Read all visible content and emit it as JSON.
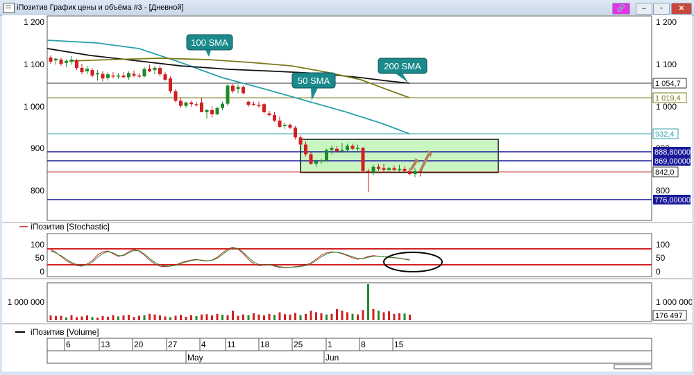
{
  "window": {
    "title": "iПозитив График цены и объёма #3 - [Дневной]",
    "pin_glyph": "🔗",
    "min_glyph": "–",
    "max_glyph": "▫",
    "close_glyph": "✕"
  },
  "price_panel": {
    "y_ticks": [
      "1 200",
      "1 100",
      "1 000",
      "900",
      "800"
    ],
    "right_ticks": [
      "1 200",
      "1 100",
      "1 000",
      "900",
      "800"
    ],
    "labels": {
      "sma100_value": "1 054,7",
      "sma200_value": "1 019,4",
      "sma50_value": "932,4",
      "level_888": "888,80000",
      "level_869": "869,00000",
      "last_close": "842,0",
      "level_776": "776,00000"
    },
    "callouts": {
      "sma100": "100 SMA",
      "sma50": "50 SMA",
      "sma200": "200 SMA"
    }
  },
  "stochastic_panel": {
    "title": "iПозитив [Stochastic]",
    "y_ticks": [
      "100",
      "50",
      "0"
    ],
    "right_ticks": [
      "100",
      "50",
      "0"
    ]
  },
  "volume_panel": {
    "y_tick": "1 000 000",
    "right_tick": "1 000 000",
    "last_volume": "176 497",
    "legend": "iПозитив [Volume]"
  },
  "time_axis": {
    "day_labels": [
      "6",
      "13",
      "20",
      "27",
      "4",
      "11",
      "18",
      "25",
      "1",
      "8",
      "15"
    ],
    "month_labels": [
      "May",
      "Jun"
    ]
  },
  "colors": {
    "up": "#1f8a2a",
    "down": "#d21f22",
    "sma100": "#2aa0ab",
    "sma200": "#7a7a18",
    "sma_black": "#111111",
    "level_blue": "#1a1a9a",
    "support": "#d21f22",
    "callout": "#1b8a8c",
    "zone_fill": "#c8f5c2"
  },
  "chart_data": [
    {
      "type": "candlestick",
      "ylim": [
        760,
        1200
      ],
      "candles": [
        {
          "o": 1115,
          "h": 1120,
          "l": 1100,
          "c": 1105
        },
        {
          "o": 1108,
          "h": 1115,
          "l": 1098,
          "c": 1112
        },
        {
          "o": 1110,
          "h": 1114,
          "l": 1095,
          "c": 1100
        },
        {
          "o": 1102,
          "h": 1110,
          "l": 1092,
          "c": 1107
        },
        {
          "o": 1105,
          "h": 1118,
          "l": 1098,
          "c": 1110
        },
        {
          "o": 1108,
          "h": 1112,
          "l": 1085,
          "c": 1090
        },
        {
          "o": 1090,
          "h": 1100,
          "l": 1075,
          "c": 1080
        },
        {
          "o": 1082,
          "h": 1095,
          "l": 1075,
          "c": 1088
        },
        {
          "o": 1085,
          "h": 1090,
          "l": 1068,
          "c": 1072
        },
        {
          "o": 1075,
          "h": 1085,
          "l": 1060,
          "c": 1078
        },
        {
          "o": 1076,
          "h": 1082,
          "l": 1058,
          "c": 1065
        },
        {
          "o": 1066,
          "h": 1080,
          "l": 1060,
          "c": 1075
        },
        {
          "o": 1072,
          "h": 1080,
          "l": 1065,
          "c": 1070
        },
        {
          "o": 1070,
          "h": 1078,
          "l": 1064,
          "c": 1072
        },
        {
          "o": 1072,
          "h": 1080,
          "l": 1066,
          "c": 1068
        },
        {
          "o": 1068,
          "h": 1082,
          "l": 1062,
          "c": 1078
        },
        {
          "o": 1076,
          "h": 1084,
          "l": 1068,
          "c": 1072
        },
        {
          "o": 1072,
          "h": 1078,
          "l": 1066,
          "c": 1070
        },
        {
          "o": 1070,
          "h": 1092,
          "l": 1068,
          "c": 1088
        },
        {
          "o": 1088,
          "h": 1098,
          "l": 1080,
          "c": 1082
        },
        {
          "o": 1085,
          "h": 1095,
          "l": 1075,
          "c": 1090
        },
        {
          "o": 1090,
          "h": 1096,
          "l": 1070,
          "c": 1075
        },
        {
          "o": 1075,
          "h": 1080,
          "l": 1060,
          "c": 1062
        },
        {
          "o": 1065,
          "h": 1070,
          "l": 1030,
          "c": 1035
        },
        {
          "o": 1035,
          "h": 1040,
          "l": 1008,
          "c": 1012
        },
        {
          "o": 1012,
          "h": 1020,
          "l": 995,
          "c": 1000
        },
        {
          "o": 1000,
          "h": 1010,
          "l": 995,
          "c": 1008
        },
        {
          "o": 1008,
          "h": 1012,
          "l": 998,
          "c": 1004
        },
        {
          "o": 1004,
          "h": 1010,
          "l": 998,
          "c": 1002
        },
        {
          "o": 1008,
          "h": 1020,
          "l": 990,
          "c": 985
        },
        {
          "o": 985,
          "h": 992,
          "l": 970,
          "c": 990
        },
        {
          "o": 990,
          "h": 1000,
          "l": 972,
          "c": 980
        },
        {
          "o": 980,
          "h": 998,
          "l": 978,
          "c": 995
        },
        {
          "o": 995,
          "h": 1010,
          "l": 990,
          "c": 1005
        },
        {
          "o": 1005,
          "h": 1052,
          "l": 1000,
          "c": 1048
        },
        {
          "o": 1048,
          "h": 1052,
          "l": 1030,
          "c": 1035
        },
        {
          "o": 1040,
          "h": 1050,
          "l": 1030,
          "c": 1045
        },
        {
          "o": 1045,
          "h": 1048,
          "l": 1028,
          "c": 1030
        },
        {
          "o": 1010,
          "h": 1012,
          "l": 998,
          "c": 1002
        },
        {
          "o": 1005,
          "h": 1010,
          "l": 1000,
          "c": 1004
        },
        {
          "o": 1002,
          "h": 1010,
          "l": 995,
          "c": 1000
        },
        {
          "o": 1004,
          "h": 1006,
          "l": 982,
          "c": 985
        },
        {
          "o": 982,
          "h": 988,
          "l": 975,
          "c": 978
        },
        {
          "o": 978,
          "h": 985,
          "l": 962,
          "c": 965
        },
        {
          "o": 965,
          "h": 975,
          "l": 948,
          "c": 950
        },
        {
          "o": 952,
          "h": 960,
          "l": 945,
          "c": 955
        },
        {
          "o": 955,
          "h": 958,
          "l": 945,
          "c": 948
        },
        {
          "o": 948,
          "h": 952,
          "l": 920,
          "c": 925
        },
        {
          "o": 925,
          "h": 930,
          "l": 905,
          "c": 908
        },
        {
          "o": 908,
          "h": 915,
          "l": 880,
          "c": 885
        },
        {
          "o": 885,
          "h": 890,
          "l": 860,
          "c": 862
        },
        {
          "o": 862,
          "h": 872,
          "l": 855,
          "c": 868
        },
        {
          "o": 868,
          "h": 875,
          "l": 862,
          "c": 870
        },
        {
          "o": 870,
          "h": 898,
          "l": 868,
          "c": 895
        },
        {
          "o": 895,
          "h": 905,
          "l": 885,
          "c": 900
        },
        {
          "o": 898,
          "h": 905,
          "l": 888,
          "c": 892
        },
        {
          "o": 892,
          "h": 912,
          "l": 888,
          "c": 895
        },
        {
          "o": 895,
          "h": 910,
          "l": 890,
          "c": 905
        },
        {
          "o": 905,
          "h": 910,
          "l": 895,
          "c": 898
        },
        {
          "o": 898,
          "h": 908,
          "l": 890,
          "c": 900
        },
        {
          "o": 900,
          "h": 902,
          "l": 840,
          "c": 845
        },
        {
          "o": 845,
          "h": 850,
          "l": 795,
          "c": 842
        },
        {
          "o": 842,
          "h": 860,
          "l": 835,
          "c": 855
        },
        {
          "o": 855,
          "h": 862,
          "l": 845,
          "c": 850
        },
        {
          "o": 852,
          "h": 862,
          "l": 840,
          "c": 848
        },
        {
          "o": 848,
          "h": 855,
          "l": 840,
          "c": 852
        },
        {
          "o": 852,
          "h": 858,
          "l": 845,
          "c": 848
        },
        {
          "o": 848,
          "h": 860,
          "l": 842,
          "c": 850
        },
        {
          "o": 850,
          "h": 856,
          "l": 840,
          "c": 845
        },
        {
          "o": 845,
          "h": 852,
          "l": 835,
          "c": 838
        },
        {
          "o": 838,
          "h": 852,
          "l": 830,
          "c": 845
        },
        {
          "o": 845,
          "h": 850,
          "l": 832,
          "c": 842
        }
      ]
    },
    {
      "type": "line",
      "title": "iПозитив [Stochastic]",
      "ylim": [
        0,
        100
      ],
      "series": [
        {
          "values": [
            80,
            70,
            55,
            40,
            30,
            22,
            20,
            28,
            40,
            60,
            72,
            75,
            65,
            55,
            60,
            72,
            80,
            74,
            60,
            42,
            28,
            20,
            18,
            20,
            25,
            32,
            38,
            42,
            45,
            40,
            38,
            42,
            52,
            68,
            82,
            88,
            82,
            65,
            45,
            28,
            22,
            24,
            26,
            20,
            16,
            15,
            16,
            18,
            20,
            24,
            32,
            45,
            60,
            68,
            72,
            70,
            65,
            58,
            50,
            45,
            48,
            55,
            58,
            56,
            54,
            52,
            50,
            48,
            45,
            42
          ]
        },
        {
          "values": [
            75,
            68,
            58,
            45,
            34,
            26,
            22,
            24,
            34,
            52,
            66,
            72,
            68,
            58,
            58,
            68,
            76,
            76,
            64,
            48,
            34,
            24,
            20,
            20,
            23,
            29,
            35,
            40,
            43,
            42,
            39,
            41,
            48,
            62,
            76,
            86,
            84,
            70,
            52,
            35,
            26,
            23,
            25,
            22,
            18,
            16,
            16,
            17,
            19,
            22,
            28,
            40,
            54,
            64,
            70,
            70,
            67,
            60,
            54,
            48,
            47,
            52,
            56,
            56,
            54,
            53,
            51,
            49,
            46,
            43
          ]
        }
      ]
    },
    {
      "type": "bar",
      "title": "iПозитив [Volume]",
      "ylim": [
        0,
        1200000
      ],
      "values": [
        150000,
        130000,
        140000,
        90000,
        160000,
        100000,
        120000,
        150000,
        100000,
        80000,
        130000,
        110000,
        160000,
        120000,
        150000,
        170000,
        100000,
        140000,
        160000,
        200000,
        180000,
        150000,
        120000,
        100000,
        140000,
        170000,
        110000,
        160000,
        130000,
        180000,
        190000,
        150000,
        200000,
        170000,
        160000,
        300000,
        140000,
        180000,
        160000,
        220000,
        180000,
        150000,
        200000,
        170000,
        250000,
        190000,
        180000,
        230000,
        160000,
        200000,
        300000,
        250000,
        220000,
        180000,
        200000,
        350000,
        300000,
        250000,
        200000,
        180000,
        320000,
        1130000,
        350000,
        300000,
        250000,
        280000,
        200000,
        220000,
        210000,
        176497
      ]
    }
  ]
}
